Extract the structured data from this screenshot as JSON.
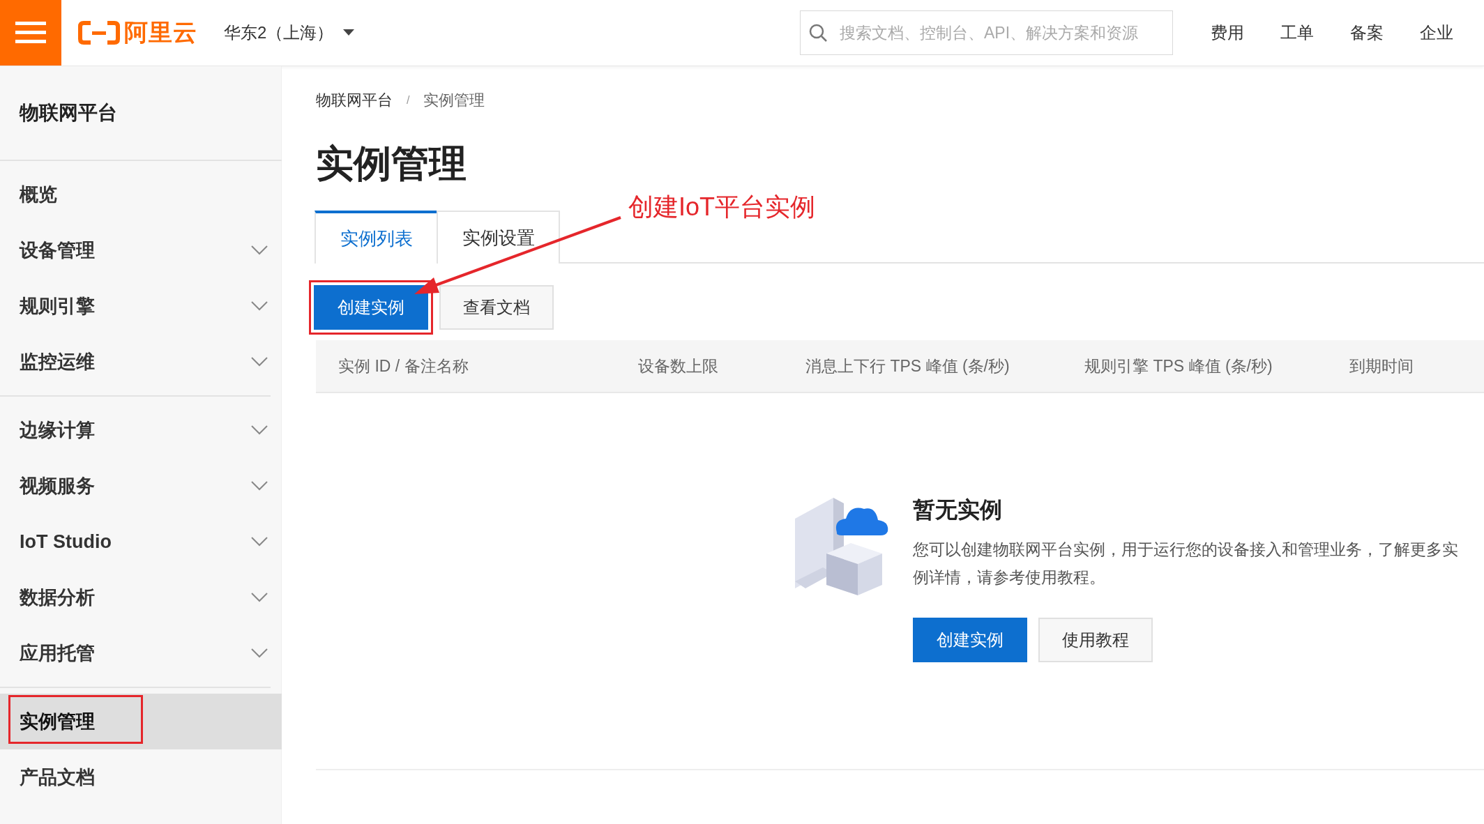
{
  "topbar": {
    "logo_text": "阿里云",
    "region": "华东2（上海）",
    "search": {
      "placeholder": "搜索文档、控制台、API、解决方案和资源"
    },
    "nav": [
      "费用",
      "工单",
      "备案",
      "企业"
    ]
  },
  "sidebar": {
    "title": "物联网平台",
    "sections": [
      [
        {
          "label": "概览",
          "kind": "link",
          "selected": false,
          "highlighted": false
        },
        {
          "label": "设备管理",
          "kind": "group",
          "selected": false,
          "highlighted": false
        },
        {
          "label": "规则引擎",
          "kind": "group",
          "selected": false,
          "highlighted": false
        },
        {
          "label": "监控运维",
          "kind": "group",
          "selected": false,
          "highlighted": false
        }
      ],
      [
        {
          "label": "边缘计算",
          "kind": "group",
          "selected": false,
          "highlighted": false
        },
        {
          "label": "视频服务",
          "kind": "group",
          "selected": false,
          "highlighted": false
        },
        {
          "label": "IoT Studio",
          "kind": "group",
          "selected": false,
          "highlighted": false
        },
        {
          "label": "数据分析",
          "kind": "group",
          "selected": false,
          "highlighted": false
        },
        {
          "label": "应用托管",
          "kind": "group",
          "selected": false,
          "highlighted": false
        }
      ],
      [
        {
          "label": "实例管理",
          "kind": "link",
          "selected": true,
          "highlighted": true
        },
        {
          "label": "产品文档",
          "kind": "link",
          "selected": false,
          "highlighted": false
        }
      ]
    ]
  },
  "breadcrumb": {
    "items": [
      "物联网平台",
      "实例管理"
    ],
    "separator": "/"
  },
  "page_title": "实例管理",
  "tabs": [
    {
      "label": "实例列表",
      "selected": true
    },
    {
      "label": "实例设置",
      "selected": false
    }
  ],
  "annotation": {
    "text": "创建IoT平台实例"
  },
  "toolbar": [
    {
      "label": "创建实例",
      "kind": "primary",
      "highlighted": true
    },
    {
      "label": "查看文档",
      "kind": "secondary",
      "highlighted": false
    }
  ],
  "table": {
    "columns": [
      "实例 ID / 备注名称",
      "设备数上限",
      "消息上下行 TPS 峰值 (条/秒)",
      "规则引擎 TPS 峰值 (条/秒)",
      "到期时间"
    ]
  },
  "empty_state": {
    "title": "暂无实例",
    "description": "您可以创建物联网平台实例，用于运行您的设备接入和管理业务，了解更多实例详情，请参考使用教程。",
    "buttons": [
      {
        "label": "创建实例",
        "kind": "primary"
      },
      {
        "label": "使用教程",
        "kind": "secondary"
      }
    ]
  }
}
